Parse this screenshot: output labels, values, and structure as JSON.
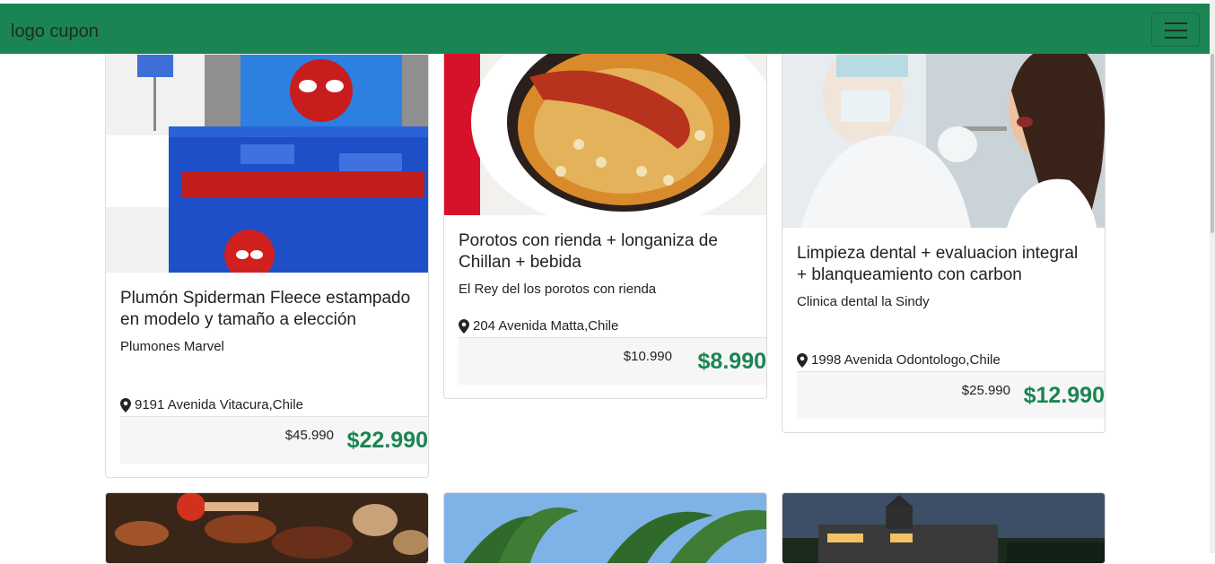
{
  "navbar": {
    "brand": "logo cupon",
    "toggle_icon": "hamburger-icon",
    "background": "#1a8553"
  },
  "cards": [
    {
      "title": "Plumón Spiderman Fleece estampado en modelo y tamaño a elección",
      "merchant": "Plumones Marvel",
      "location": "9191 Avenida Vitacura,Chile",
      "old_price": "$45.990",
      "new_price": "$22.990",
      "image": "spiderman-bedding-photo"
    },
    {
      "title": "Porotos con rienda + longaniza de Chillan + bebida",
      "merchant": "El Rey del los porotos con rienda",
      "location": "204 Avenida Matta,Chile",
      "old_price": "$10.990",
      "new_price": "$8.990",
      "image": "porotos-dish-photo"
    },
    {
      "title": "Limpieza dental + evaluacion integral + blanqueamiento con carbon",
      "merchant": "Clinica dental la Sindy",
      "location": "1998 Avenida Odontologo,Chile",
      "old_price": "$25.990",
      "new_price": "$12.990",
      "image": "dentist-photo"
    },
    {
      "image": "bbq-grill-photo"
    },
    {
      "image": "palm-trees-photo"
    },
    {
      "image": "evening-building-photo"
    }
  ],
  "colors": {
    "accent": "#1a8553",
    "price_box": "#f6f6f6"
  }
}
